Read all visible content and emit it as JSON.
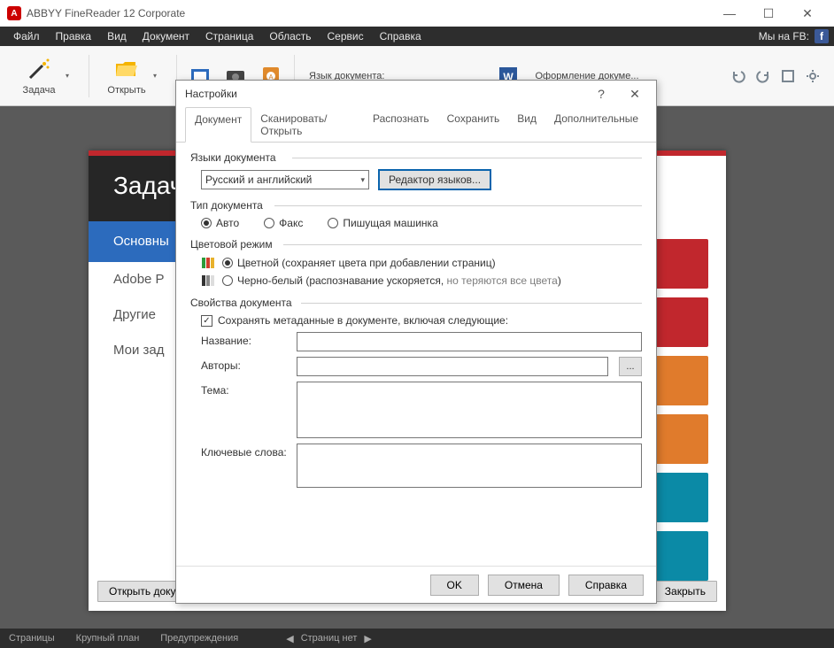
{
  "app": {
    "title": "ABBYY FineReader 12 Corporate"
  },
  "menu": {
    "items": [
      "Файл",
      "Правка",
      "Вид",
      "Документ",
      "Страница",
      "Область",
      "Сервис",
      "Справка"
    ],
    "fb_label": "Мы на FB:"
  },
  "toolbar": {
    "task": "Задача",
    "open": "Открыть",
    "doclang_label": "Язык документа:",
    "doclayout_label": "Оформление докуме..."
  },
  "task_panel": {
    "title": "Задач",
    "active": "Основны",
    "items": [
      "Adobe P",
      "Другие",
      "Мои зад"
    ],
    "open_doc": "Открыть докуме",
    "close": "Закрыть"
  },
  "statusbar": {
    "pages": "Страницы",
    "zoom": "Крупный план",
    "warnings": "Предупреждения",
    "nopages": "Страниц нет"
  },
  "dialog": {
    "title": "Настройки",
    "tabs": [
      "Документ",
      "Сканировать/Открыть",
      "Распознать",
      "Сохранить",
      "Вид",
      "Дополнительные"
    ],
    "sec_lang": "Языки документа",
    "lang_value": "Русский и английский",
    "lang_editor": "Редактор языков...",
    "sec_type": "Тип документа",
    "type_auto": "Авто",
    "type_fax": "Факс",
    "type_typewriter": "Пишущая машинка",
    "sec_color": "Цветовой режим",
    "color_full": "Цветной (сохраняет цвета при добавлении страниц)",
    "color_bw_a": "Черно-белый (распознавание ускоряется, ",
    "color_bw_b": "но теряются все цвета",
    "color_bw_c": ")",
    "sec_props": "Свойства документа",
    "keep_meta": "Сохранять метаданные в документе, включая следующие:",
    "lbl_title": "Название:",
    "lbl_authors": "Авторы:",
    "lbl_subject": "Тема:",
    "lbl_keywords": "Ключевые слова:",
    "ok": "OK",
    "cancel": "Отмена",
    "help": "Справка"
  }
}
